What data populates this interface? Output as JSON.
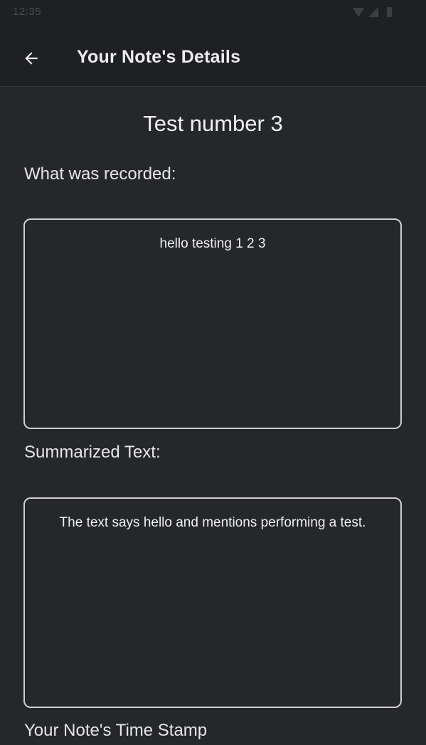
{
  "status_bar": {
    "time": "12:35",
    "icons": [
      "wifi-icon",
      "signal-icon",
      "battery-icon"
    ]
  },
  "app_bar": {
    "back_icon": "arrow-left-icon",
    "title": "Your Note's Details"
  },
  "note": {
    "title": "Test number 3",
    "recorded_label": "What was recorded:",
    "recorded_text": "hello testing 1 2 3",
    "summary_label": "Summarized Text:",
    "summary_text": "The text says hello and mentions performing a test.",
    "timestamp_label": "Your Note's Time Stamp"
  },
  "colors": {
    "background": "#25272a",
    "app_bar": "#1f2023",
    "border": "#cfcfcf",
    "text": "#ececec"
  }
}
